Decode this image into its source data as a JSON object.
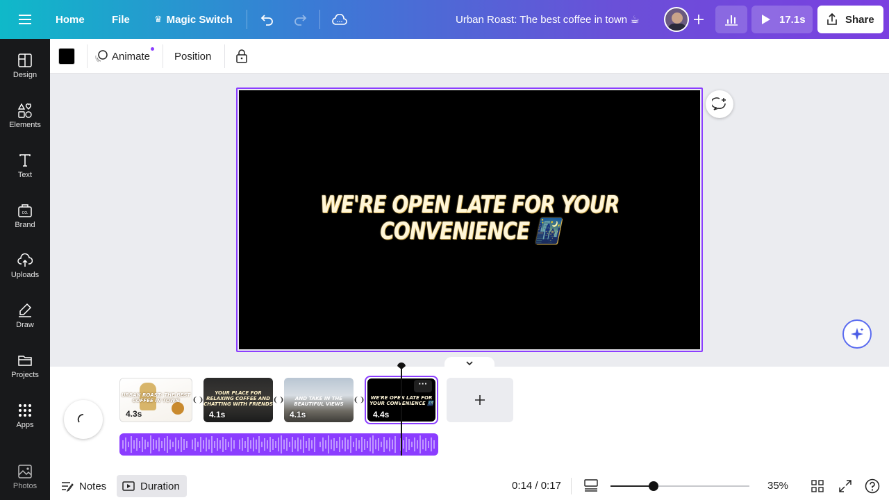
{
  "topbar": {
    "home": "Home",
    "file": "File",
    "magic_switch": "Magic Switch",
    "doc_title": "Urban Roast: The best coffee in town ☕",
    "play_time": "17.1s",
    "share": "Share"
  },
  "sidebar": {
    "items": [
      {
        "label": "Design",
        "icon": "design-icon"
      },
      {
        "label": "Elements",
        "icon": "elements-icon"
      },
      {
        "label": "Text",
        "icon": "text-icon"
      },
      {
        "label": "Brand",
        "icon": "brand-icon"
      },
      {
        "label": "Uploads",
        "icon": "uploads-icon"
      },
      {
        "label": "Draw",
        "icon": "draw-icon"
      },
      {
        "label": "Projects",
        "icon": "projects-icon"
      },
      {
        "label": "Apps",
        "icon": "apps-icon"
      },
      {
        "label": "Photos",
        "icon": "photos-icon"
      }
    ]
  },
  "toolbar": {
    "color": "#000000",
    "animate": "Animate",
    "position": "Position"
  },
  "slide": {
    "line1": "WE'RE OPEN LATE FOR YOUR",
    "line2": "CONVENIENCE 🌃"
  },
  "timeline": {
    "pages": [
      {
        "duration": "4.3s",
        "caption": "URBAN ROAST: THE BEST COFFEE IN TOWN"
      },
      {
        "duration": "4.1s",
        "caption": "YOUR PLACE FOR RELAXING COFFEE AND CHATTING WITH FRIENDS"
      },
      {
        "duration": "4.1s",
        "caption": "AND TAKE IN THE BEAUTIFUL VIEWS"
      },
      {
        "duration": "4.4s",
        "caption": "WE'RE OPEN LATE FOR YOUR CONVENIENCE 🌃"
      }
    ]
  },
  "bottombar": {
    "notes": "Notes",
    "duration": "Duration",
    "time": "0:14 / 0:17",
    "zoom": "35%",
    "zoom_level": 0.35
  },
  "colors": {
    "accent": "#8b3dff",
    "sidebar_bg": "#18191b"
  }
}
